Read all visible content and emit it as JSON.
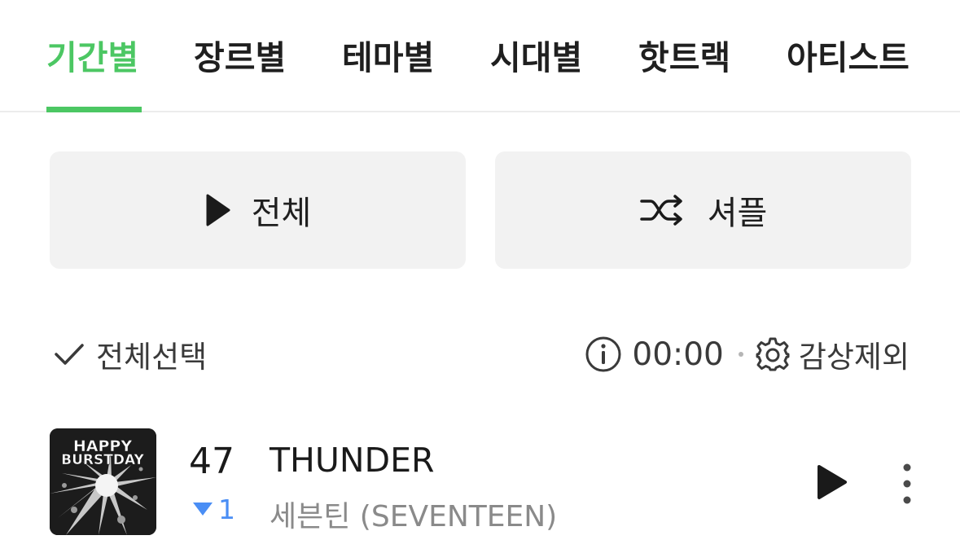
{
  "tabs": [
    {
      "label": "기간별",
      "active": true
    },
    {
      "label": "장르별",
      "active": false
    },
    {
      "label": "테마별",
      "active": false
    },
    {
      "label": "시대별",
      "active": false
    },
    {
      "label": "핫트랙",
      "active": false
    },
    {
      "label": "아티스트",
      "active": false
    }
  ],
  "colors": {
    "accent": "#4cc763",
    "rank_down": "#4a8ef5"
  },
  "actions": {
    "play_all_label": "전체",
    "play_all_icon": "play-icon",
    "shuffle_label": "셔플",
    "shuffle_icon": "shuffle-icon"
  },
  "toolbar": {
    "select_all_label": "전체선택",
    "select_all_icon": "check-icon",
    "duration": "00:00",
    "info_icon": "info-icon",
    "settings_icon": "gear-icon",
    "exclude_label": "감상제외"
  },
  "track": {
    "cover_text_line1": "HAPPY",
    "cover_text_line2": "BURSTDAY",
    "rank": "47",
    "rank_change": "1",
    "rank_direction": "down",
    "title": "THUNDER",
    "artist": "세븐틴 (SEVENTEEN)"
  }
}
